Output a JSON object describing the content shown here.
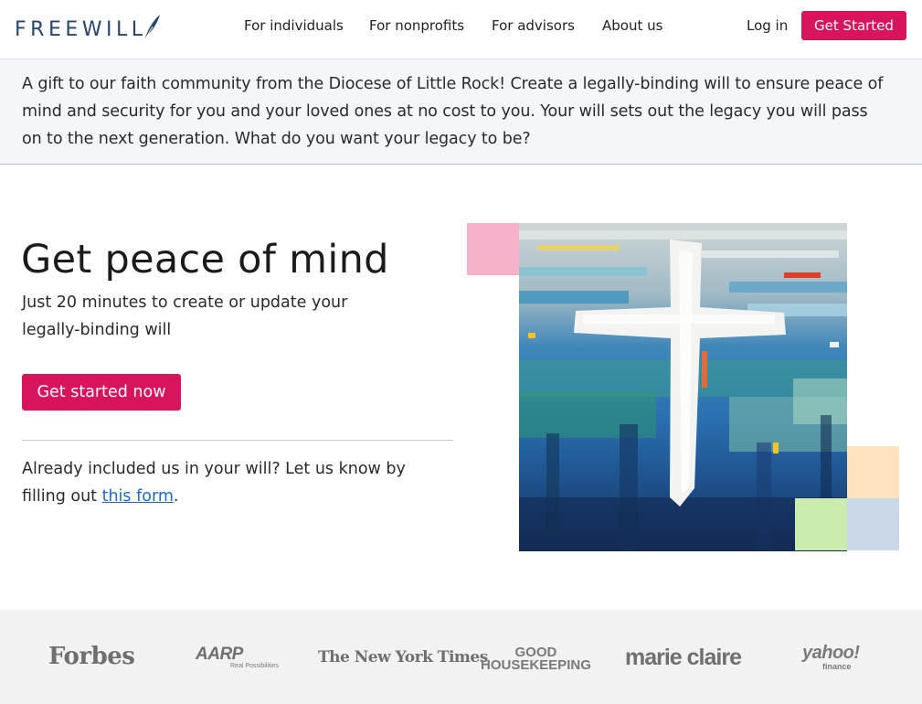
{
  "header": {
    "logo_text": "FREEWILL",
    "nav": [
      "For individuals",
      "For nonprofits",
      "For advisors",
      "About us"
    ],
    "login_label": "Log in",
    "cta_label": "Get Started"
  },
  "banner": {
    "text": "A gift to our faith community from the Diocese of Little Rock! Create a legally-binding will to ensure peace of mind and security for you and your loved ones at no cost to you. Your will sets out the legacy you will pass on to the next generation. What do you want your legacy to be?"
  },
  "hero": {
    "title": "Get peace of mind",
    "subtitle": "Just 20 minutes to create or update your legally-binding will",
    "cta_label": "Get started now",
    "already_text": "Already included us in your will? Let us know by filling out ",
    "already_link": "this form",
    "already_end": "."
  },
  "press": {
    "forbes": "Forbes",
    "aarp": "AARP",
    "aarp_sub": "Real Possibilities",
    "nyt": "The New York Times",
    "gh_line1": "GOOD",
    "gh_line2": "HOUSEKEEPING",
    "marieclaire": "marie claire",
    "yahoo": "yahoo!",
    "yahoo_sub": "finance"
  },
  "colors": {
    "brand_pink": "#d8145c",
    "logo_navy": "#28466a",
    "link_blue": "#1f68c8",
    "banner_bg": "#f4f6f9"
  },
  "icons": {
    "logo_mark": "quill-icon",
    "hero_art": "cross-painting"
  }
}
